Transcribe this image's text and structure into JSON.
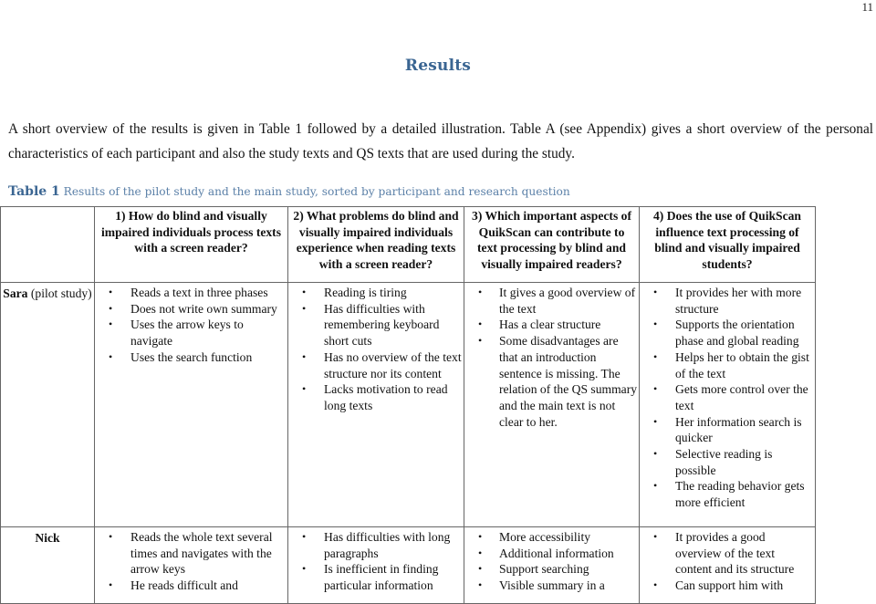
{
  "page_number": "11",
  "section_heading": "Results",
  "intro_paragraph": "A short overview of the results is given in Table 1 followed by a detailed illustration. Table A (see Appendix) gives a short overview of the personal characteristics of each participant and also the study texts and QS texts that are used during the study.",
  "caption": {
    "label": "Table 1",
    "text": " Results of the pilot study and the main study, sorted by participant and research question"
  },
  "table": {
    "headers": [
      "",
      "1) How do blind and visually impaired individuals process texts with a screen reader?",
      "2) What problems do blind and visually impaired individuals experience when reading texts with a screen reader?",
      "3) Which important aspects of QuikScan can contribute to text processing by blind and visually impaired readers?",
      "4) Does the use of QuikScan influence text processing of blind and visually impaired students?"
    ],
    "rows": [
      {
        "participant_name": "Sara",
        "participant_note": " (pilot study)",
        "q1": [
          "Reads a text in three phases",
          "Does not write own summary",
          "Uses the arrow keys to navigate",
          "Uses the search function"
        ],
        "q2": [
          "Reading is tiring",
          "Has difficulties with remembering keyboard short cuts",
          "Has no overview of the text structure nor its content",
          "Lacks motivation to read long texts"
        ],
        "q3": [
          "It gives a good overview of the text",
          "Has a clear structure",
          "Some disadvantages are that an introduction sentence is missing. The relation of the QS summary and the main text is not clear to her."
        ],
        "q4": [
          "It provides her with more structure",
          "Supports the orientation phase and global reading",
          "Helps her to obtain the gist of the text",
          "Gets more control over the text",
          "Her information search is quicker",
          "Selective reading is possible",
          "The reading behavior gets more efficient"
        ]
      },
      {
        "participant_name": "Nick",
        "participant_note": "",
        "q1": [
          "Reads the whole text several times and navigates with the arrow keys",
          "He reads difficult and"
        ],
        "q2": [
          "Has difficulties with long paragraphs",
          "Is inefficient in finding particular information"
        ],
        "q3": [
          "More accessibility",
          "Additional information",
          "Support searching",
          "Visible summary in a"
        ],
        "q4": [
          "It provides a good overview of the text content and its structure",
          "Can support him with"
        ]
      }
    ]
  },
  "bullet_glyph": "•"
}
